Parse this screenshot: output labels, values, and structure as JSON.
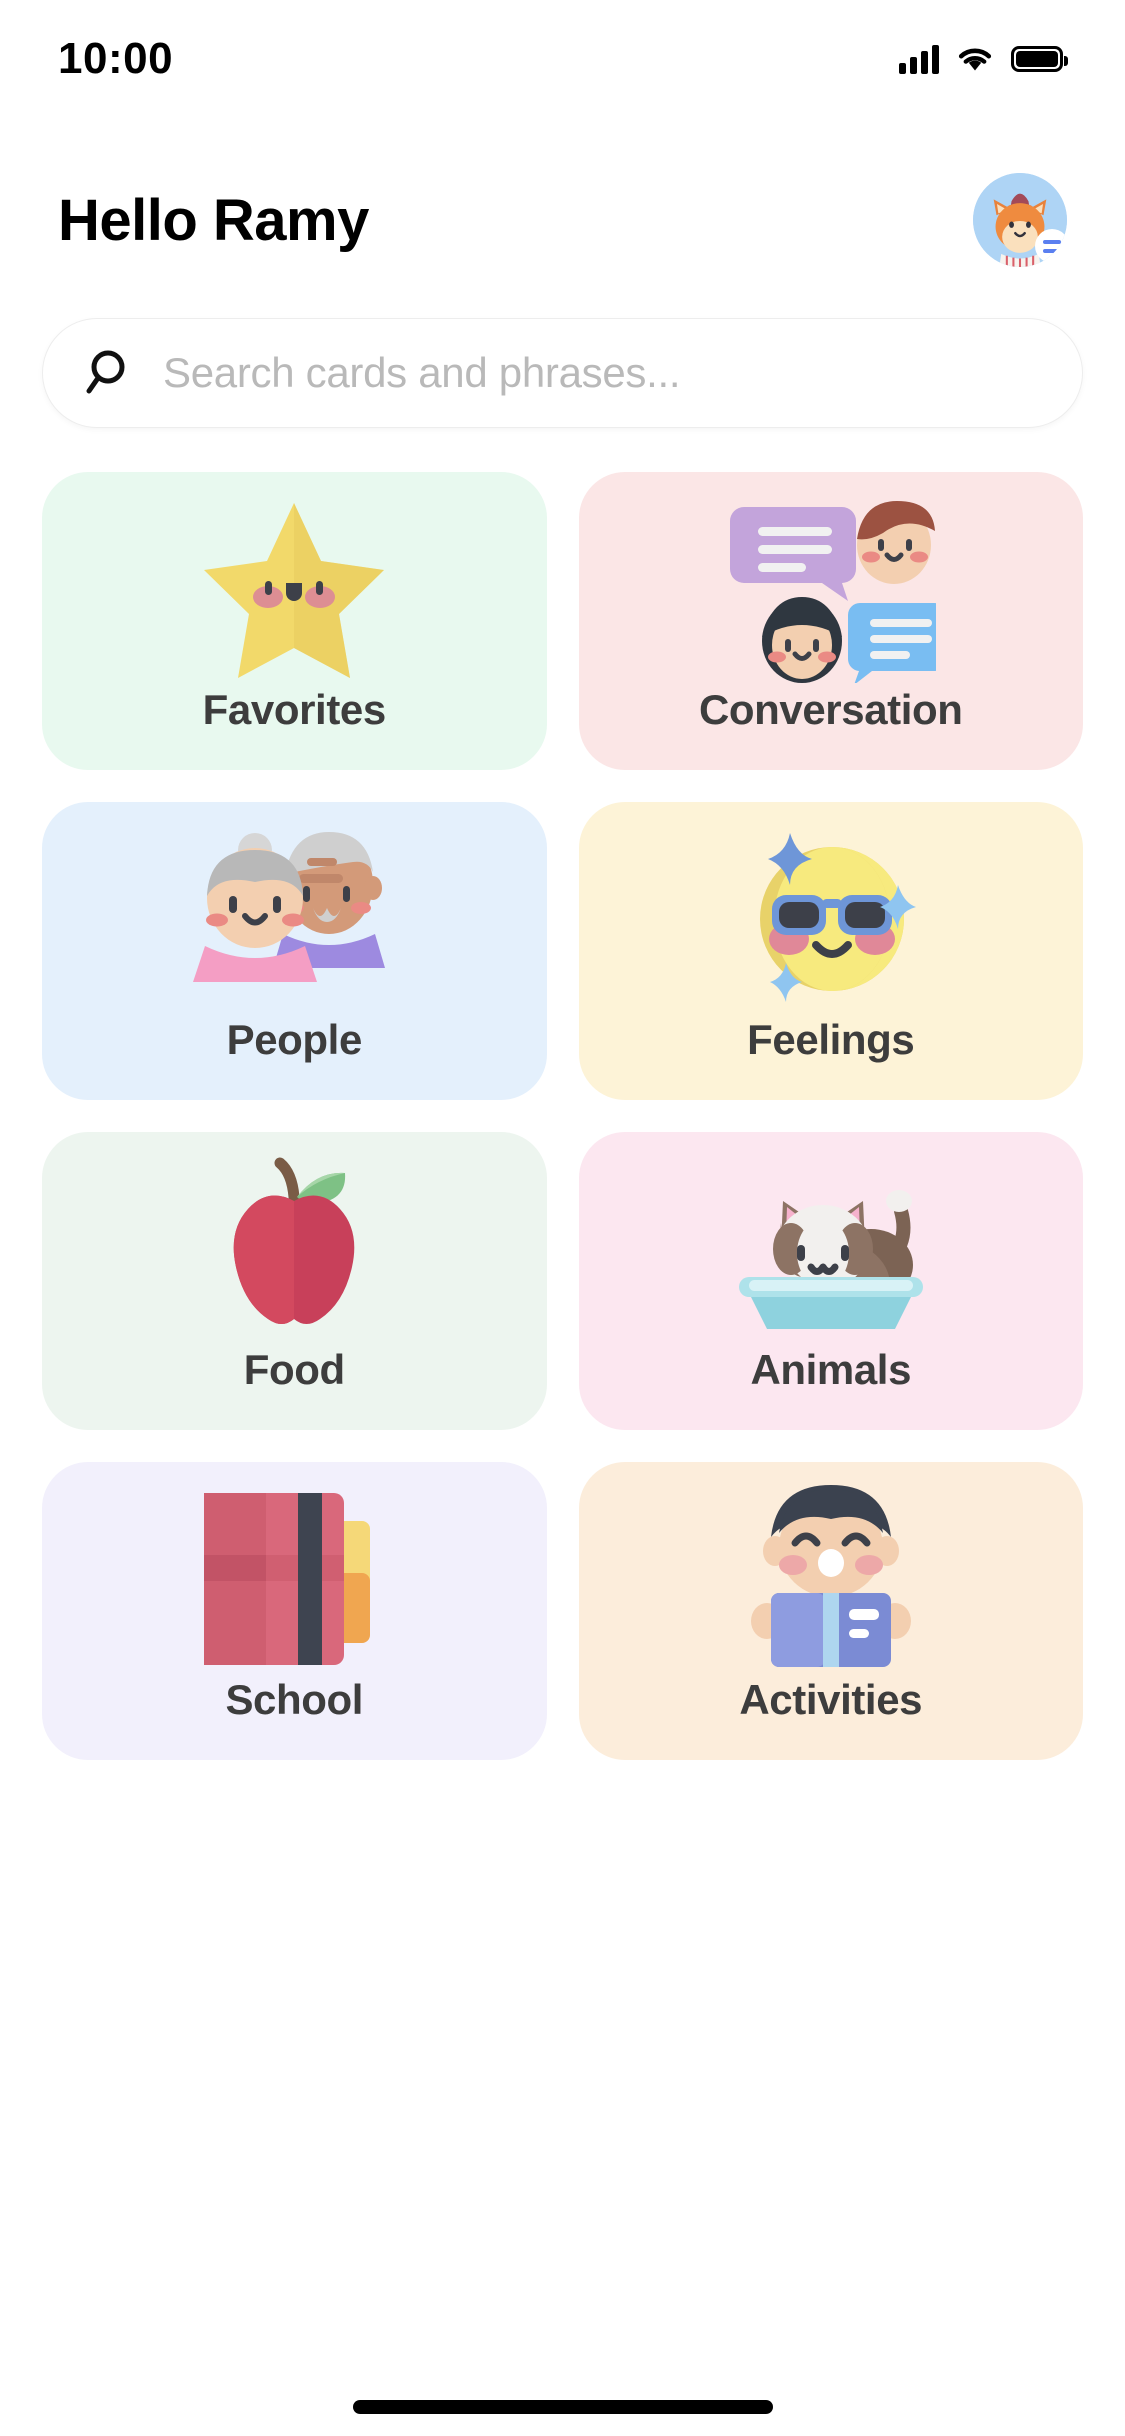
{
  "status_bar": {
    "time": "10:00",
    "signal_icon": "cellular-signal-icon",
    "wifi_icon": "wifi-icon",
    "battery_icon": "battery-full-icon"
  },
  "header": {
    "greeting": "Hello Ramy",
    "avatar_icon": "fox-avatar",
    "avatar_badge_icon": "menu-badge-icon"
  },
  "search": {
    "icon": "search-icon",
    "placeholder": "Search cards and phrases...",
    "value": ""
  },
  "colors": {
    "favorites_bg": "#e8f9ef",
    "conversation_bg": "#fbe6e6",
    "people_bg": "#e4f0fc",
    "feelings_bg": "#fdf3d7",
    "food_bg": "#edf5ef",
    "animals_bg": "#fce7f0",
    "school_bg": "#f2f0fc",
    "activities_bg": "#fceddb",
    "label_text": "#3d3d3d",
    "placeholder_text": "#b9b9b9",
    "badge_accent": "#5a7ff0"
  },
  "categories": [
    {
      "label": "Favorites",
      "icon": "star-face-icon",
      "bg": "#e8f9ef"
    },
    {
      "label": "Conversation",
      "icon": "speech-people-icon",
      "bg": "#fbe6e6"
    },
    {
      "label": "People",
      "icon": "elderly-couple-icon",
      "bg": "#e4f0fc"
    },
    {
      "label": "Feelings",
      "icon": "cool-emoji-icon",
      "bg": "#fdf3d7"
    },
    {
      "label": "Food",
      "icon": "apple-icon",
      "bg": "#edf5ef"
    },
    {
      "label": "Animals",
      "icon": "cat-in-basin-icon",
      "bg": "#fce7f0"
    },
    {
      "label": "School",
      "icon": "notebook-icon",
      "bg": "#f2f0fc"
    },
    {
      "label": "Activities",
      "icon": "child-reading-icon",
      "bg": "#fceddb"
    }
  ],
  "home_indicator": "home-indicator-bar"
}
